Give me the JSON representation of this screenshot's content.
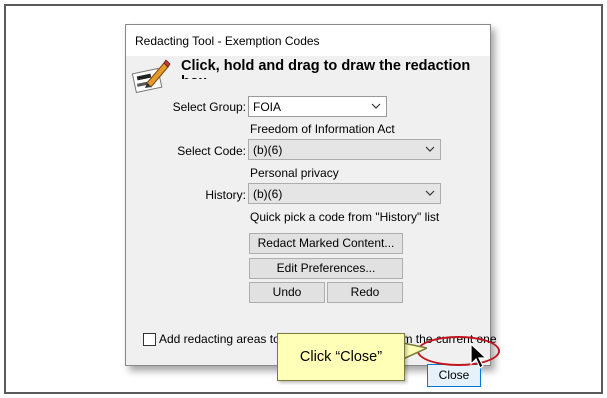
{
  "dialog": {
    "title": "Redacting Tool - Exemption Codes",
    "instruction": "Click, hold and drag to draw the redaction box",
    "select_group": {
      "label": "Select Group:",
      "value": "FOIA",
      "description": "Freedom of Information Act"
    },
    "select_code": {
      "label": "Select Code:",
      "value": "(b)(6)",
      "description": "Personal privacy"
    },
    "history": {
      "label": "History:",
      "value": "(b)(6)",
      "description": "Quick pick a code from \"History\" list"
    },
    "buttons": {
      "redact_marked": "Redact Marked Content...",
      "edit_preferences": "Edit Preferences...",
      "undo": "Undo",
      "redo": "Redo",
      "close": "Close"
    },
    "checkbox": {
      "label": "Add redacting areas to every page starting from the current one",
      "checked": false
    }
  },
  "callout": {
    "text": "Click “Close”"
  },
  "colors": {
    "highlight_ring": "#c0161d",
    "callout_bg": "#ffffb8",
    "focus_border": "#0078d7"
  },
  "icons": [
    "redaction-pen-icon",
    "chevron-down-icon",
    "mouse-cursor-icon"
  ]
}
